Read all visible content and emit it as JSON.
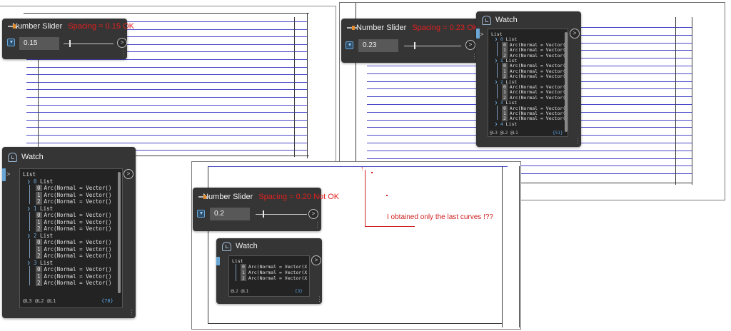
{
  "colors": {
    "accent": "#e02020",
    "wire": "#4848c8",
    "node_bg": "#353535",
    "port": "#6aa6d6"
  },
  "node_labels": {
    "slider_title": "Number Slider",
    "watch_title": "Watch",
    "output_port": ">"
  },
  "sliders": [
    {
      "note": "Spacing = 0.15 OK",
      "value": "0.15"
    },
    {
      "note": "Spacing = 0.23 OK",
      "value": "0.23"
    },
    {
      "note": "Spacing = 0.20 Not OK",
      "value": "0.2"
    }
  ],
  "watch_root": "List",
  "watch_big": {
    "groups": [
      {
        "label": "0 List",
        "items": [
          "0 Arc(Normal = Vector()",
          "1 Arc(Normal = Vector()",
          "2 Arc(Normal = Vector()"
        ]
      },
      {
        "label": "1 List",
        "items": [
          "0 Arc(Normal = Vector()",
          "1 Arc(Normal = Vector()",
          "2 Arc(Normal = Vector()"
        ]
      },
      {
        "label": "2 List",
        "items": [
          "0 Arc(Normal = Vector()",
          "1 Arc(Normal = Vector()",
          "2 Arc(Normal = Vector()"
        ]
      },
      {
        "label": "3 List",
        "items": [
          "0 Arc(Normal = Vector()",
          "1 Arc(Normal = Vector()",
          "2 Arc(Normal = Vector()"
        ]
      }
    ],
    "levels": "@L3 @L2 @L1",
    "count": "{78}"
  },
  "watch_small": {
    "groups": [
      {
        "label": "0 List",
        "items": [
          "0 Arc(Normal = Vector()",
          "1 Arc(Normal = Vector()",
          "2 Arc(Normal = Vector()"
        ]
      },
      {
        "label": "1 List",
        "items": [
          "0 Arc(Normal = Vector()",
          "1 Arc(Normal = Vector()",
          "2 Arc(Normal = Vector()"
        ]
      },
      {
        "label": "2 List",
        "items": [
          "0 Arc(Normal = Vector()",
          "1 Arc(Normal = Vector()",
          "2 Arc(Normal = Vector()"
        ]
      },
      {
        "label": "3 List",
        "items": [
          "0 Arc(Normal = Vector()",
          "1 Arc(Normal = Vector()",
          "2 Arc(Normal = Vector()"
        ]
      },
      {
        "label": "4 List",
        "items": []
      }
    ],
    "levels": "@L3 @L2 @L1",
    "count": "{51}"
  },
  "watch_flat": {
    "items": [
      "0 Arc(Normal = Vector(X =",
      "1 Arc(Normal = Vector(X =",
      "2 Arc(Normal = Vector(X ="
    ],
    "levels": "@L2 @L1",
    "count": "{3}"
  },
  "annotation": "I obtained only the last curves !??"
}
